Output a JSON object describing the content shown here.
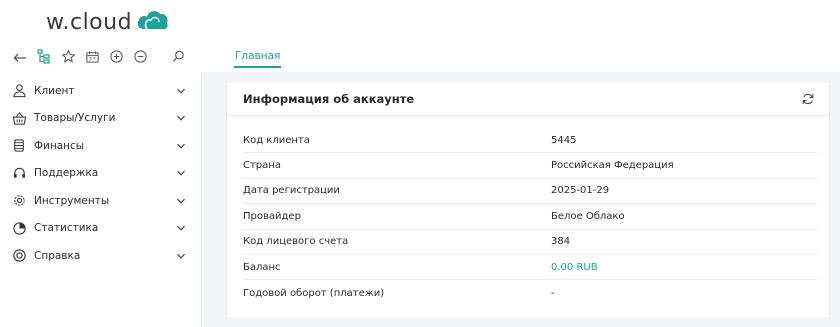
{
  "brand": {
    "logo_text": "w.cloud",
    "accent_color": "#1aa39f"
  },
  "toolbar": {
    "icons": [
      "back-arrow-icon",
      "tree-structure-icon",
      "star-icon",
      "calendar-icon",
      "plus-circle-icon",
      "minus-circle-icon",
      "search-icon"
    ]
  },
  "tabs": [
    {
      "label": "Главная",
      "active": true
    }
  ],
  "sidebar": {
    "items": [
      {
        "label": "Клиент",
        "icon": "user-icon"
      },
      {
        "label": "Товары/Услуги",
        "icon": "basket-icon"
      },
      {
        "label": "Финансы",
        "icon": "coins-icon"
      },
      {
        "label": "Поддержка",
        "icon": "headset-icon"
      },
      {
        "label": "Инструменты",
        "icon": "gear-icon"
      },
      {
        "label": "Статистика",
        "icon": "pie-chart-icon"
      },
      {
        "label": "Справка",
        "icon": "lifebuoy-icon"
      }
    ]
  },
  "account_card": {
    "title": "Информация об аккаунте",
    "rows": [
      {
        "key": "Код клиента",
        "value": "5445"
      },
      {
        "key": "Страна",
        "value": "Российская Федерация"
      },
      {
        "key": "Дата регистрации",
        "value": "2025-01-29"
      },
      {
        "key": "Провайдер",
        "value": "Белое Облако"
      },
      {
        "key": "Код лицевого счета",
        "value": "384"
      },
      {
        "key": "Баланс",
        "value": "0.00 RUB"
      },
      {
        "key": "Годовой оборот (платежи)",
        "value": "-"
      }
    ]
  }
}
